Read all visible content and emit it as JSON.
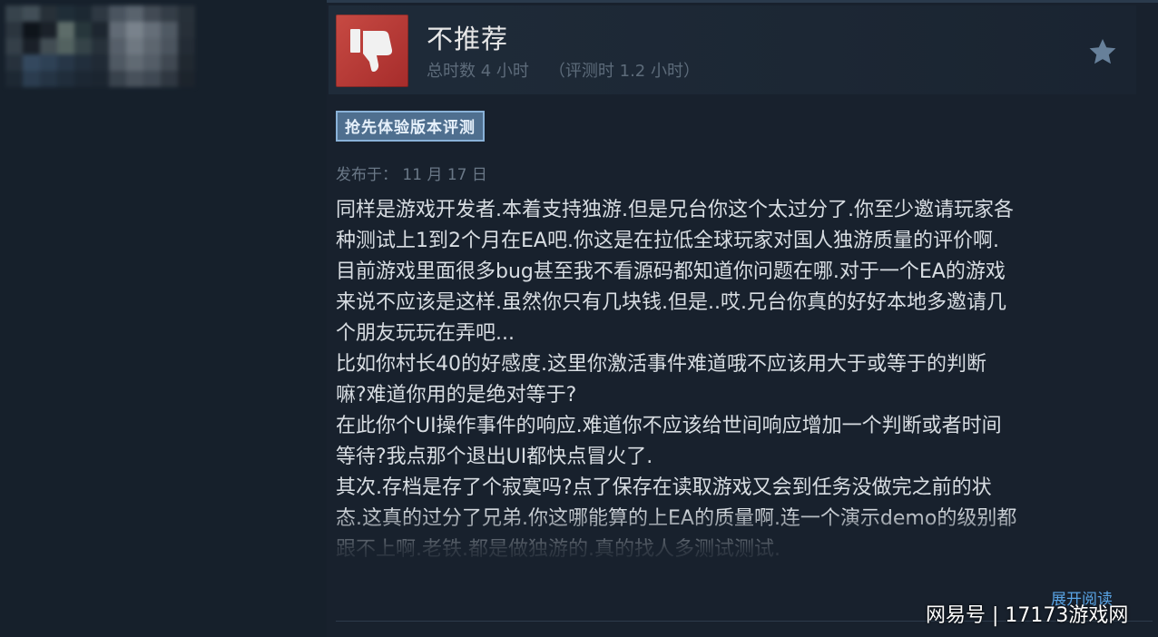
{
  "review": {
    "verdict": "不推荐",
    "total_hours": "总时数 4 小时",
    "hours_at_review": "（评测时 1.2 小时）",
    "early_access_badge": "抢先体验版本评测",
    "posted_date": "发布于：  11 月 17 日",
    "text_lines": [
      "同样是游戏开发者.本着支持独游.但是兄台你这个太过分了.你至少邀请玩家各",
      "种测试上1到2个月在EA吧.你这是在拉低全球玩家对国人独游质量的评价啊.",
      "目前游戏里面很多bug甚至我不看源码都知道你问题在哪.对于一个EA的游戏",
      "来说不应该是这样.虽然你只有几块钱.但是..哎.兄台你真的好好本地多邀请几",
      "个朋友玩玩在弄吧...",
      "比如你村长40的好感度.这里你激活事件难道哦不应该用大于或等于的判断",
      "嘛?难道你用的是绝对等于?",
      "在此你个UI操作事件的响应.难道你不应该给世间响应增加一个判断或者时间",
      "等待?我点那个退出UI都快点冒火了.",
      "其次.存档是存了个寂寞吗?点了保存在读取游戏又会到任务没做完之前的状",
      "态.这真的过分了兄弟.你这哪能算的上EA的质量啊.连一个演示demo的级别都",
      "跟不上啊.老铁.都是做独游的.真的找人多测试测试."
    ],
    "read_more": "展开阅读"
  },
  "icons": {
    "verdict_icon": "thumbs-down-icon",
    "award_icon": "star-icon"
  },
  "watermark": "网易号 | 17173游戏网",
  "colors": {
    "background": "#18212d",
    "thumb_red": "#b8383a",
    "badge_bg": "#4f6f8f",
    "link_blue": "#5aa5e6",
    "text": "#d8dde2",
    "muted": "#5d6b7a"
  }
}
